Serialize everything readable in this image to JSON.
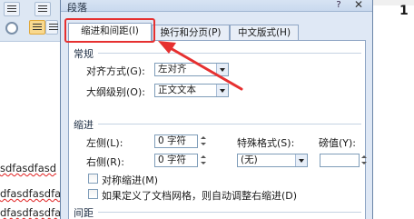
{
  "background_doc": {
    "lines": [
      "sdfasdfasd",
      "dfasdfasdfa",
      "dfasdfasdfa",
      "sdfasdfasdf"
    ],
    "right_char": "1"
  },
  "dialog": {
    "title": "段落",
    "help": "?",
    "close": "✕",
    "tabs": [
      "缩进和间距(I)",
      "换行和分页(P)",
      "中文版式(H)"
    ],
    "general": {
      "section_label": "常规",
      "alignment_label": "对齐方式(G):",
      "alignment_value": "左对齐",
      "outline_label": "大纲级别(O):",
      "outline_value": "正文文本"
    },
    "indent": {
      "section_label": "缩进",
      "left_label": "左侧(L):",
      "left_value": "0 字符",
      "right_label": "右侧(R):",
      "right_value": "0 字符",
      "special_label": "特殊格式(S):",
      "special_value": "(无)",
      "by_label": "磅值(Y):",
      "by_value": "",
      "mirror_label": "对称缩进(M)",
      "grid_label": "如果定义了文档网格，则自动调整右缩进(D)"
    },
    "spacing": {
      "section_label": "间距"
    }
  },
  "colors": {
    "annotation": "#e63030",
    "dialog_bg": "#dfe8f5"
  }
}
